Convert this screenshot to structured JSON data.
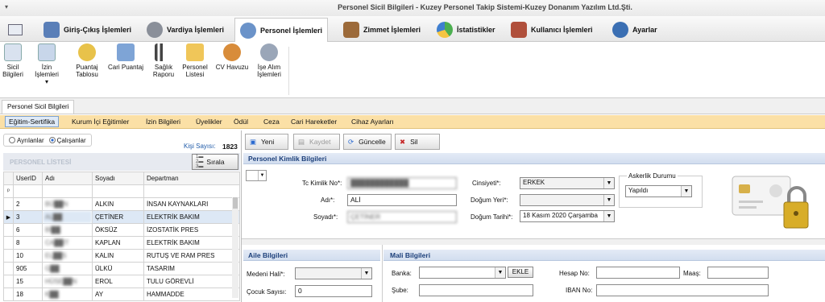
{
  "window": {
    "title": "Personel Sicil Bilgileri - Kuzey Personel Takip Sistemi-Kuzey Donanım Yazılım Ltd.Şti.",
    "quick_access": "▾"
  },
  "main_tabs": [
    {
      "label": "Giriş-Çıkış İşlemleri",
      "icon": "door-users-icon"
    },
    {
      "label": "Vardiya İşlemleri",
      "icon": "gears-icon"
    },
    {
      "label": "Personel İşlemleri",
      "icon": "person-icon"
    },
    {
      "label": "Zimmet İşlemleri",
      "icon": "desk-worker-icon"
    },
    {
      "label": "İstatistikler",
      "icon": "pie-chart-icon"
    },
    {
      "label": "Kullanıcı İşlemleri",
      "icon": "users-icon"
    },
    {
      "label": "Ayarlar",
      "icon": "gear-icon"
    }
  ],
  "ribbon": [
    {
      "label": "Sicil Bilgileri",
      "icon": "id-card-icon"
    },
    {
      "label": "İzin İşlemleri",
      "icon": "person-leave-icon"
    },
    {
      "label": "Puantaj Tablosu",
      "icon": "timesheet-icon"
    },
    {
      "label": "Cari Puantaj",
      "icon": "account-icon"
    },
    {
      "label": "Sağlık Raporu",
      "icon": "bar-chart-icon"
    },
    {
      "label": "Personel Listesi",
      "icon": "folder-icon"
    },
    {
      "label": "CV Havuzu",
      "icon": "cv-pool-icon"
    },
    {
      "label": "İşe Alım İşlemleri",
      "icon": "hiring-icon"
    }
  ],
  "doc_tab": "Personel Sicil Bilgileri",
  "sub_tabs": [
    "Eğitim-Sertifika",
    "Kurum İçi Eğitimler",
    "İzin Bilgileri",
    "Üyelikler",
    "Ödül",
    "Ceza",
    "Cari Hareketler",
    "Cihaz Ayarları"
  ],
  "filter": {
    "option1": "Ayrılanlar",
    "option2": "Çalışanlar",
    "selected": "Çalışanlar"
  },
  "count": {
    "label": "Kişi Sayısı:",
    "value": "1823"
  },
  "list": {
    "title": "PERSONEL LİSTESİ",
    "sort_label": "Sırala",
    "columns": [
      "UserID",
      "Adı",
      "Soyadı",
      "Departman"
    ],
    "rows": [
      [
        "2",
        "BÜ██N",
        "ALKIN",
        "İNSAN KAYNAKLARI"
      ],
      [
        "3",
        "AL██",
        "ÇETİNER",
        "ELEKTRİK BAKIM"
      ],
      [
        "6",
        "Bİ██",
        "ÖKSÜZ",
        "İZOSTATİK PRES"
      ],
      [
        "8",
        "CA██İT",
        "KAPLAN",
        "ELEKTRİK BAKIM"
      ],
      [
        "10",
        "EL██S",
        "KALIN",
        "RUTUŞ VE RAM PRES"
      ],
      [
        "905",
        "G██",
        "ÜLKÜ",
        "TASARIM"
      ],
      [
        "15",
        "HÜSE██N",
        "EROL",
        "TULU GÖREVLİ"
      ],
      [
        "18",
        "K██",
        "AY",
        "HAMMADDE"
      ]
    ],
    "selected_row": 1
  },
  "toolbar": {
    "new": "Yeni",
    "save": "Kaydet",
    "update": "Güncelle",
    "delete": "Sil"
  },
  "identity": {
    "section": "Personel Kimlik Bilgileri",
    "tc_label": "Tc Kimlik No*:",
    "tc_value": "████████████",
    "ad_label": "Adı*:",
    "ad_value": "ALİ",
    "soyad_label": "Soyadı*:",
    "soyad_value": "ÇETİNER",
    "cinsiyet_label": "Cinsiyeti*:",
    "cinsiyet_value": "ERKEK",
    "dogumyeri_label": "Doğum Yeri*:",
    "dogumyeri_value": "",
    "dogumtarihi_label": "Doğum Tarihi*:",
    "dogumtarihi_value": "18   Kasım   2020 Çarşamba",
    "asker_label": "Askerlik Durumu",
    "asker_value": "Yapıldı"
  },
  "family": {
    "section": "Aile Bilgileri",
    "medeni_label": "Medeni Hali*:",
    "medeni_value": "",
    "cocuk_label": "Çocuk Sayısı:",
    "cocuk_value": "0"
  },
  "finance": {
    "section": "Mali Bilgileri",
    "banka_label": "Banka:",
    "banka_value": "",
    "ekle": "EKLE",
    "sube_label": "Şube:",
    "sube_value": "",
    "hesap_label": "Hesap No:",
    "hesap_value": "",
    "maas_label": "Maaş:",
    "maas_value": "",
    "iban_label": "IBAN No:",
    "iban_value": ""
  },
  "colors": {
    "subtab_bg": "#fbe0a6",
    "section_text": "#1c3f7a",
    "accent": "#1f5aa8"
  }
}
